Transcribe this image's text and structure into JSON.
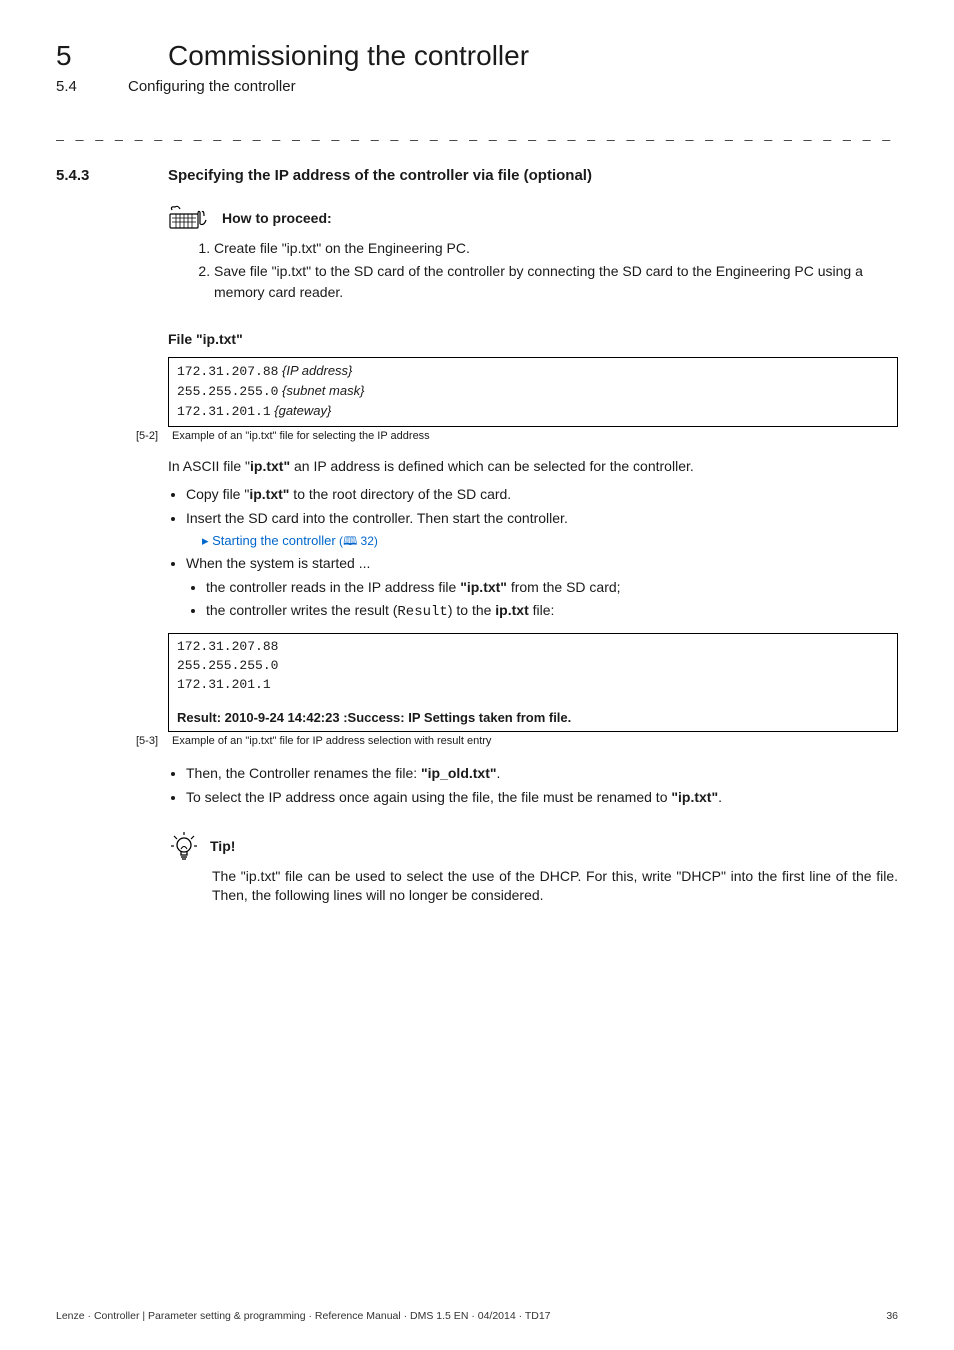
{
  "header": {
    "chapter_num": "5",
    "chapter_title": "Commissioning the controller",
    "section_num": "5.4",
    "section_title": "Configuring the controller"
  },
  "divider": "_ _ _ _ _ _ _ _ _ _ _ _ _ _ _ _ _ _ _ _ _ _ _ _ _ _ _ _ _ _ _ _ _ _ _ _ _ _ _ _ _ _ _ _ _ _ _ _ _ _ _ _ _ _ _ _ _ _ _ _ _ _ _ _",
  "section": {
    "num": "5.4.3",
    "title": "Specifying the IP address of the controller via file (optional)"
  },
  "how_to_proceed": {
    "label": "How to proceed:",
    "steps": [
      "Create file \"ip.txt\" on the Engineering PC.",
      "Save file \"ip.txt\" to the SD card of the controller by connecting the SD card to the Engineering PC using a memory card reader."
    ]
  },
  "file_block": {
    "title": "File \"ip.txt\"",
    "lines": [
      {
        "code": "172.31.207.88",
        "note": "{IP address}"
      },
      {
        "code": "255.255.255.0",
        "note": "{subnet mask}"
      },
      {
        "code": "172.31.201.1",
        "note": "{gateway}"
      }
    ],
    "caption_tag": "[5-2]",
    "caption_text": "Example of an \"ip.txt\" file for selecting the IP address"
  },
  "ascii_para": {
    "p1a": "In ASCII file \"",
    "p1b": "ip.txt\"",
    "p1c": " an IP address is defined which can be selected for the controller."
  },
  "bullets1": {
    "b1a": "Copy file \"",
    "b1b": "ip.txt\"",
    "b1c": " to the root directory of the SD card.",
    "b2": "Insert the SD card into the controller. Then start the controller.",
    "b2_link_arrow": "▸ ",
    "b2_link": "Starting the controller",
    "b2_pageref_open": " (",
    "b2_pageref_icon": "🕮",
    "b2_pageref_num": " 32)",
    "b3": "When the system is started ...",
    "b3_sub1a": "the controller reads in the IP address file ",
    "b3_sub1b": "\"ip.txt\"",
    "b3_sub1c": " from the SD card;",
    "b3_sub2a": "the controller writes the result (",
    "b3_sub2b": "Result",
    "b3_sub2c": ") to the ",
    "b3_sub2d": "ip.txt",
    "b3_sub2e": " file:"
  },
  "result_block": {
    "lines": [
      "172.31.207.88",
      "255.255.255.0",
      "172.31.201.1"
    ],
    "result_line": "Result: 2010-9-24 14:42:23 :Success: IP Settings taken from file.",
    "caption_tag": "[5-3]",
    "caption_text": "Example of an \"ip.txt\" file for IP address selection with result entry"
  },
  "bullets2": {
    "b1a": "Then, the Controller renames the file: ",
    "b1b": "\"ip_old.txt\"",
    "b1c": ".",
    "b2a": "To select the IP address once again using the file, the file must be renamed to ",
    "b2b": "\"ip.txt\"",
    "b2c": "."
  },
  "tip": {
    "label": "Tip!",
    "body": "The \"ip.txt\" file can be used to select the use of the DHCP. For this, write \"DHCP\" into the first line of the file. Then, the following lines will no longer be considered."
  },
  "footer": {
    "left": "Lenze · Controller |  Parameter setting & programming · Reference Manual · DMS 1.5 EN · 04/2014 · TD17",
    "right": "36"
  }
}
